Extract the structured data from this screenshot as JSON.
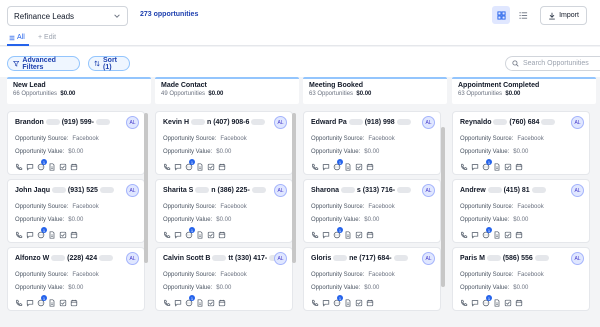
{
  "toolbar": {
    "pipeline": "Refinance Leads",
    "opportunity_count": "273 opportunities",
    "import_label": "Import"
  },
  "tabs": {
    "all": "All",
    "add": "+ Edit"
  },
  "filters": {
    "advanced": "Advanced Filters",
    "sort": "Sort (1)",
    "search_placeholder": "Search Opportunities"
  },
  "labels": {
    "source": "Opportunity Source:",
    "value": "Opportunity Value:",
    "avatar": "AL"
  },
  "columns": [
    {
      "title": "New Lead",
      "count": "66 Opportunities",
      "amount": "$0.00",
      "cards": [
        {
          "name_a": "Brandon",
          "name_b": "(919) 599-",
          "source": "Facebook",
          "value": "$0.00"
        },
        {
          "name_a": "John Jaqu",
          "name_b": "(931) 525",
          "source": "Facebook",
          "value": "$0.00"
        },
        {
          "name_a": "Alfonzo W",
          "name_b": "(228) 424",
          "source": "Facebook",
          "value": "$0.00"
        }
      ]
    },
    {
      "title": "Made Contact",
      "count": "49 Opportunities",
      "amount": "$0.00",
      "cards": [
        {
          "name_a": "Kevin H",
          "name_b": "n (407) 908-6",
          "source": "Facebook",
          "value": "$0.00"
        },
        {
          "name_a": "Sharita S",
          "name_b": "n (386) 225-",
          "source": "Facebook",
          "value": "$0.00"
        },
        {
          "name_a": "Calvin Scott B",
          "name_b": "tt (330) 417-",
          "source": "Facebook",
          "value": "$0.00"
        }
      ]
    },
    {
      "title": "Meeting Booked",
      "count": "63 Opportunities",
      "amount": "$0.00",
      "cards": [
        {
          "name_a": "Edward Pa",
          "name_b": "(918) 998",
          "source": "Facebook",
          "value": "$0.00"
        },
        {
          "name_a": "Sharona",
          "name_b": "s (313) 716-",
          "source": "Facebook",
          "value": "$0.00"
        },
        {
          "name_a": "Gloris",
          "name_b": "ne (717) 684-",
          "source": "Facebook",
          "value": "$0.00"
        }
      ]
    },
    {
      "title": "Appointment Completed",
      "count": "63 Opportunities",
      "amount": "$0.00",
      "cards": [
        {
          "name_a": "Reynaldo",
          "name_b": "(760) 684",
          "source": "Facebook",
          "value": "$0.00"
        },
        {
          "name_a": "Andrew",
          "name_b": "(415) 81",
          "source": "Facebook",
          "value": "$0.00"
        },
        {
          "name_a": "Paris M",
          "name_b": "(586) 556",
          "source": "Facebook",
          "value": "$0.00"
        }
      ]
    }
  ],
  "colors": {
    "accent": "#2563eb",
    "column_border": "#93c5fd"
  },
  "icons": [
    "phone-icon",
    "chat-icon",
    "message-icon",
    "document-icon",
    "checkbox-icon",
    "calendar-icon"
  ]
}
